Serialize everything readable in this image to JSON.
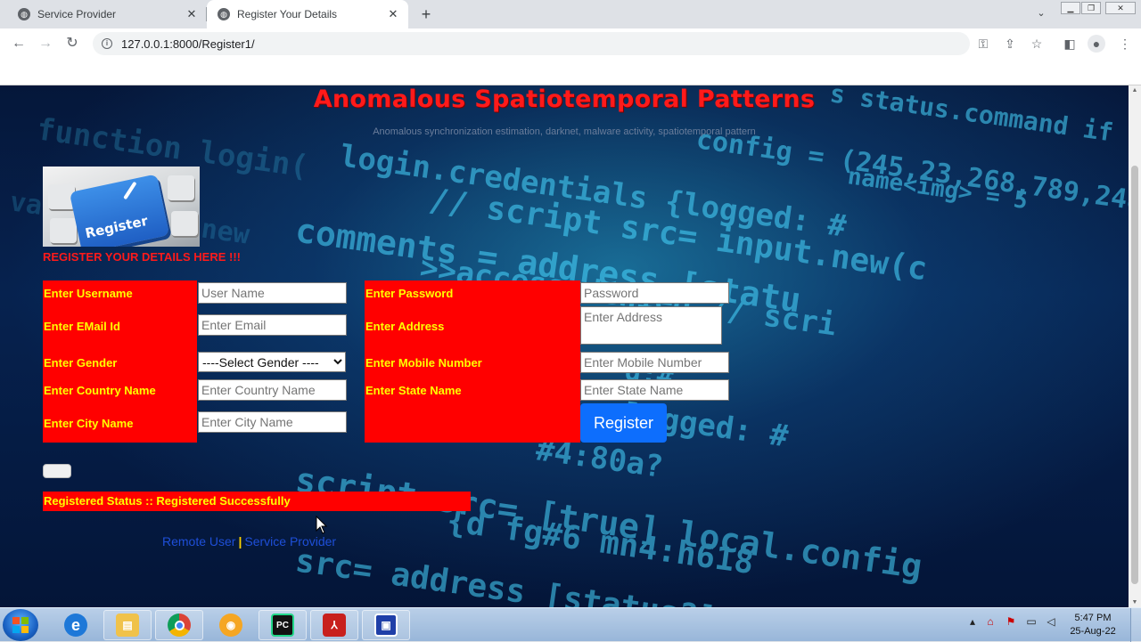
{
  "browser": {
    "tabs": [
      {
        "title": "Service Provider",
        "active": false
      },
      {
        "title": "Register Your Details",
        "active": true
      }
    ],
    "url": "127.0.0.1:8000/Register1/"
  },
  "page": {
    "title": "Anomalous Spatiotemporal Patterns",
    "subtitle": "Anomalous synchronization estimation, darknet, malware activity, spatiotemporal pattern",
    "register_image_label": "Register",
    "register_heading": "REGISTER YOUR DETAILS HERE !!!",
    "form": {
      "username_label": "Enter Username",
      "username_placeholder": "User Name",
      "email_label": "Enter EMail Id",
      "email_placeholder": "Enter Email",
      "gender_label": "Enter Gender",
      "gender_selected": "----Select Gender ----",
      "country_label": "Enter Country Name",
      "country_placeholder": "Enter Country Name",
      "city_label": "Enter City Name",
      "city_placeholder": "Enter City Name",
      "password_label": "Enter Password",
      "password_placeholder": "Password",
      "address_label": "Enter Address",
      "address_placeholder": "Enter Address",
      "mobile_label": "Enter Mobile Number",
      "mobile_placeholder": "Enter Mobile Number",
      "state_label": "Enter State Name",
      "state_placeholder": "Enter State Name",
      "register_button": "Register"
    },
    "status_text": "Registered Status :: Registered Successfully",
    "links": {
      "remote_user": "Remote User",
      "separator": "|",
      "service_provider": "Service Provider"
    }
  },
  "taskbar": {
    "apps": [
      "internet-explorer-icon",
      "file-explorer-icon",
      "chrome-icon",
      "vpn-icon",
      "pycharm-icon",
      "acrobat-icon",
      "app-window-icon"
    ],
    "clock_time": "5:47 PM",
    "clock_date": "25-Aug-22"
  },
  "colors": {
    "accent_red": "#ff0000",
    "label_yellow": "#ffff00",
    "button_blue": "#0d6efd",
    "link_blue": "#1e4fd8"
  }
}
